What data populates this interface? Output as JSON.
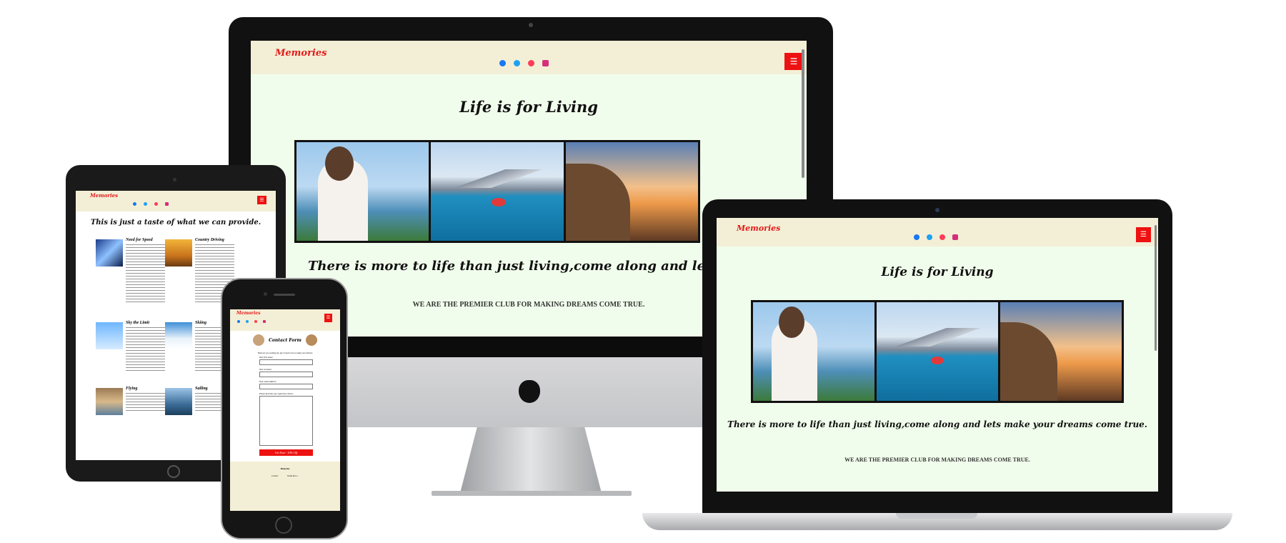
{
  "site": {
    "brand": "Memories",
    "menu_icon": "☰",
    "social_icons": [
      "facebook-icon",
      "twitter-icon",
      "youtube-icon",
      "instagram-icon"
    ],
    "hero_title": "Life is for Living",
    "tagline": "There is more to life than just living,come along and lets make your dreams come true.",
    "banner": "WE ARE THE PREMIER CLUB FOR MAKING DREAMS COME TRUE."
  },
  "tablet": {
    "heading": "This is just a taste of what we can provide.",
    "cards": [
      {
        "title": "Need for Speed"
      },
      {
        "title": "Country Driving"
      },
      {
        "title": "Sky the Limit"
      },
      {
        "title": "Skiing"
      },
      {
        "title": "Flying"
      },
      {
        "title": "Sailing"
      }
    ]
  },
  "phone": {
    "form_title": "Contact Form",
    "intro": "What are you waiting for, get in touch now to make your dreams",
    "label_first": "Your first name:",
    "label_surname": "Your surname:",
    "label_email": "Your email address:",
    "label_details": "Please describe your experience below:",
    "submit": "Get Your - 10% Off",
    "footer_brand": "Memories",
    "footer_links": [
      "Contact",
      "Terms & Co"
    ]
  },
  "colors": {
    "accent": "#ee1111",
    "nav_bg": "#f3efd6",
    "page_bg": "#f1fdec"
  }
}
